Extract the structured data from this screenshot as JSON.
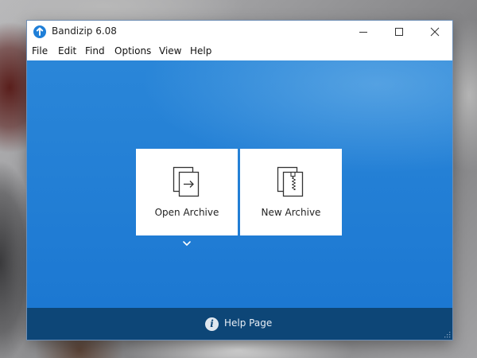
{
  "window": {
    "title": "Bandizip 6.08",
    "icon": "bandizip-logo-icon"
  },
  "title_buttons": {
    "minimize": "minimize-icon",
    "maximize": "maximize-icon",
    "close": "close-icon"
  },
  "menu": {
    "items": [
      {
        "label": "File"
      },
      {
        "label": "Edit"
      },
      {
        "label": "Find"
      },
      {
        "label": "Options"
      },
      {
        "label": "View"
      },
      {
        "label": "Help"
      }
    ]
  },
  "main": {
    "open_archive": {
      "label": "Open Archive",
      "icon": "open-archive-icon"
    },
    "new_archive": {
      "label": "New Archive",
      "icon": "new-archive-icon"
    },
    "more": {
      "icon": "chevron-down-icon"
    }
  },
  "help_bar": {
    "label": "Help Page",
    "icon": "info-icon",
    "icon_glyph": "i"
  },
  "colors": {
    "main_blue": "#1e7bd4",
    "help_bar": "#0d4677",
    "app_icon": "#1f7fd8"
  }
}
